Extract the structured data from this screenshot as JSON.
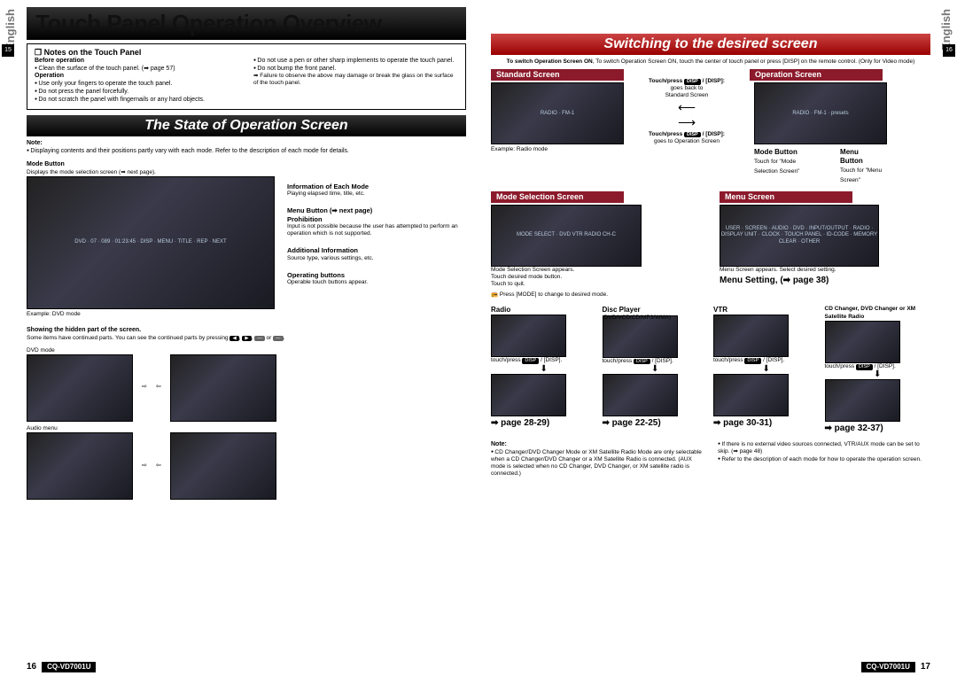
{
  "doc": {
    "title": "Touch Panel Operation Overview",
    "lang_label": "English",
    "model": "CQ-VD7001U",
    "page_left_num": "16",
    "page_right_num": "17",
    "tab_left": "15",
    "tab_right": "16"
  },
  "notes_box": {
    "heading": "❒ Notes on the Touch Panel",
    "before_op_h": "Before operation",
    "before_op_b1": "Clean the surface of the touch panel.  (➡ page 57)",
    "op_h": "Operation",
    "op_b1": "Use only your fingers to operate the touch panel.",
    "op_b2": "Do not press the panel forcefully.",
    "op_b3": "Do not scratch the panel with fingernails or any hard objects.",
    "op_r1": "Do not use a pen or other sharp implements to operate the touch panel.",
    "op_r2": "Do not bump the front panel.",
    "op_r3": "Failure to observe the above may damage or break the glass on the surface of the touch panel."
  },
  "state": {
    "heading": "The State of Operation Screen",
    "note": "Note:",
    "note_body": "Displaying contents and their positions partly vary with each mode. Refer to the description of each mode for details.",
    "mode_btn_h": "Mode Button",
    "mode_btn_b": "Displays the mode selection screen (➡ next page).",
    "example_dvd": "Example: DVD mode",
    "callouts": {
      "info_h": "Information of Each Mode",
      "info_b": "Playing elapsed time, title, etc.",
      "menu_h": "Menu Button (➡ next page)",
      "proh_h": "Prohibition",
      "proh_b": "Input is not possible because the user has attempted to perform an operation which is not supported.",
      "addl_h": "Additional Information",
      "addl_b": "Source type, various settings, etc.",
      "opbtn_h": "Operating buttons",
      "opbtn_b": "Operable touch buttons appear."
    },
    "hidden_h": "Showing the hidden part of the screen.",
    "hidden_b1": "Some items have continued parts. You can see the continued parts by pressing",
    "hidden_b2": "or",
    "hidden_b3": ".",
    "dvd_mode": "DVD mode",
    "audio_menu": "Audio menu"
  },
  "switch": {
    "heading": "Switching to the desired screen",
    "intro": "To switch Operation Screen ON, touch the center of touch panel or press [DISP] on the remote control. (Only for Video mode)",
    "std_h": "Standard Screen",
    "op_h": "Operation Screen",
    "std_cap": "Example: Radio mode",
    "touch_back_1": "Touch/press ",
    "touch_back_2": " / [DISP]:",
    "touch_back_3": "goes back to",
    "touch_back_4": "Standard Screen",
    "touch_fwd_1": "Touch/press ",
    "touch_fwd_2": " / [DISP]:",
    "touch_fwd_3": "goes to Operation Screen",
    "mode_btn_h": "Mode Button",
    "mode_btn_b": "Touch for \"Mode Selection Screen\"",
    "menu_btn_h": "Menu Button",
    "menu_btn_b": "Touch for \"Menu Screen\"",
    "msel_h": "Mode Selection Screen",
    "msel_b1": "Mode Selection Screen appears.",
    "msel_b2": "Touch desired mode button.",
    "msel_b3": "Touch          to quit.",
    "msel_note": "Press [MODE] to change to desired mode.",
    "menu_h": "Menu Screen",
    "menu_b": "Menu Screen appears. Select desired setting.",
    "menu_setting": "Menu Setting, (➡ page 38)",
    "modes": {
      "radio_h": "Radio",
      "disc_h": "Disc Player",
      "disc_sub": "(DVD/VCD/CD/MP3/WMA)",
      "vtr_h": "VTR",
      "chg_h": "CD Changer, DVD Changer or XM Satellite Radio",
      "tp": "touch/press ",
      "tp2": " / [DISP].",
      "pg_radio": "➡ page 28-29)",
      "pg_disc": "➡ page 22-25)",
      "pg_vtr": "➡ page 30-31)",
      "pg_chg": "➡ page 32-37)"
    },
    "note2_h": "Note:",
    "note2_l1": "CD Changer/DVD Changer Mode or XM Satellite Radio Mode are only selectable when a CD Changer/DVD Changer or a XM Satellite Radio is connected. (AUX mode is selected when no CD Changer, DVD Changer, or XM satellite radio is connected.)",
    "note2_r1": "If there is no external video sources connected, VTR/AUX mode can be set to skip. (➡ page 48)",
    "note2_r2": "Refer to the description of each mode for how to operate the operation screen."
  }
}
